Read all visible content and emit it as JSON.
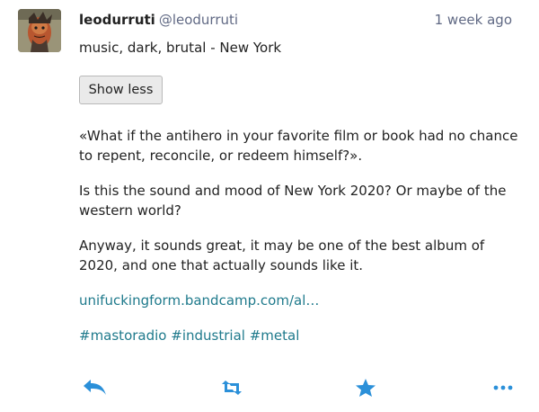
{
  "account": {
    "display_name": "leodurruti",
    "acct": "@leodurruti",
    "time": "1 week ago"
  },
  "status": {
    "spoiler_text": "music, dark, brutal - New York",
    "toggle_label": "Show less",
    "paragraphs": [
      "«What if the antihero in your favorite film or book had no chance to repent, reconcile, or redeem himself?».",
      "Is this the sound and mood of New York 2020? Or maybe of the western world?",
      "Anyway, it sounds great, it may be one of the best album of 2020, and one that actually sounds like it."
    ],
    "link": "unifuckingform.bandcamp.com/al…",
    "hashtags": [
      "#mastoradio",
      "#industrial",
      "#metal"
    ]
  },
  "actions": {
    "reply_icon": "reply-icon",
    "boost_icon": "boost-icon",
    "favourite_icon": "star-icon",
    "more_icon": "ellipsis-icon"
  },
  "colors": {
    "accent": "#2b90d9",
    "link": "#1f7a8c",
    "muted": "#606984",
    "text": "#222222"
  }
}
